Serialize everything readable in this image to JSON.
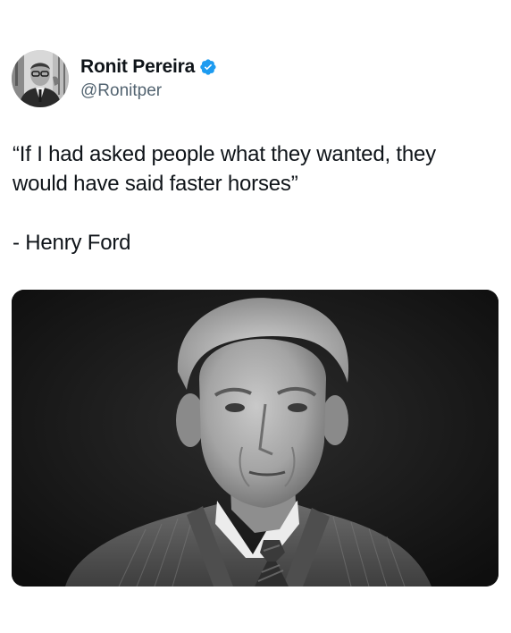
{
  "author": {
    "display_name": "Ronit Pereira",
    "handle": "@Ronitper",
    "verified": true,
    "verified_color": "#1d9bf0",
    "avatar_icon": "profile-photo-icon"
  },
  "tweet": {
    "quote_text": "“If I had asked people what they wanted, they would have said faster horses”",
    "attribution": "- Henry Ford"
  },
  "media": {
    "type": "black-and-white portrait photograph"
  }
}
